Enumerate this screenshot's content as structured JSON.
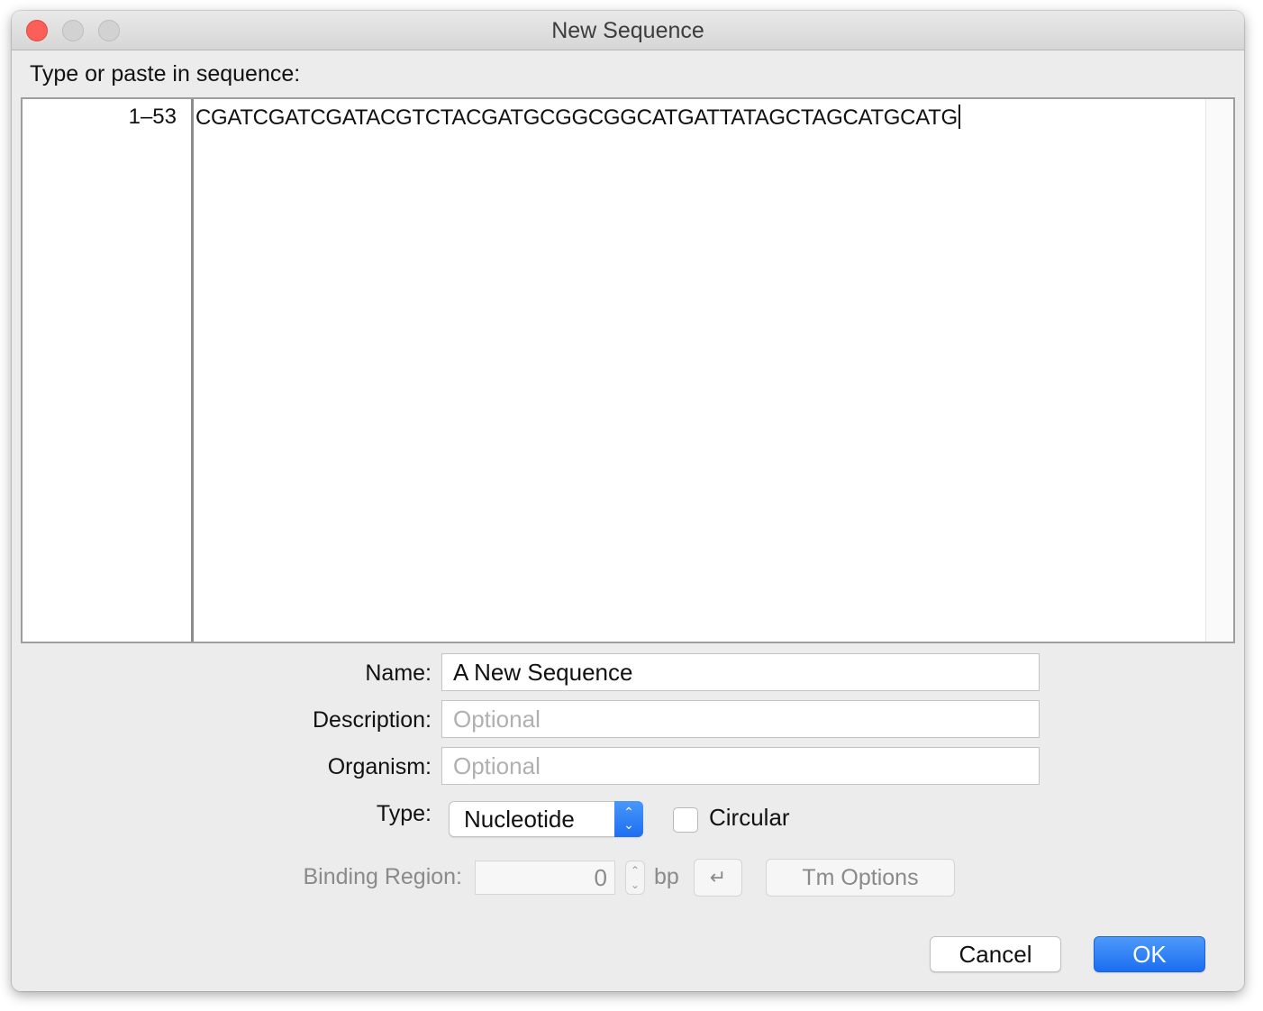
{
  "window": {
    "title": "New Sequence"
  },
  "prompt": "Type or paste in sequence:",
  "editor": {
    "range_label": "1–53",
    "sequence": "CGATCGATCGATACGTCTACGATGCGGCGGCATGATTATAGCTAGCATGCATG"
  },
  "form": {
    "name_label": "Name:",
    "name_value": "A New Sequence",
    "description_label": "Description:",
    "description_placeholder": "Optional",
    "organism_label": "Organism:",
    "organism_placeholder": "Optional",
    "type_label": "Type:",
    "type_value": "Nucleotide",
    "circular_label": "Circular",
    "circular_checked": false,
    "binding_region_label": "Binding Region:",
    "binding_region_value": "0",
    "binding_region_unit": "bp",
    "enter_symbol": "↵",
    "tm_options_label": "Tm Options"
  },
  "buttons": {
    "cancel": "Cancel",
    "ok": "OK"
  },
  "icons": {
    "close": "close-icon",
    "minimize": "minimize-icon",
    "maximize": "maximize-icon",
    "select_arrows": "chevron-updown-icon",
    "stepper": "stepper-icon",
    "enter": "return-icon"
  },
  "colors": {
    "accent": "#1b6ef1",
    "close_light": "#fc5f57"
  }
}
